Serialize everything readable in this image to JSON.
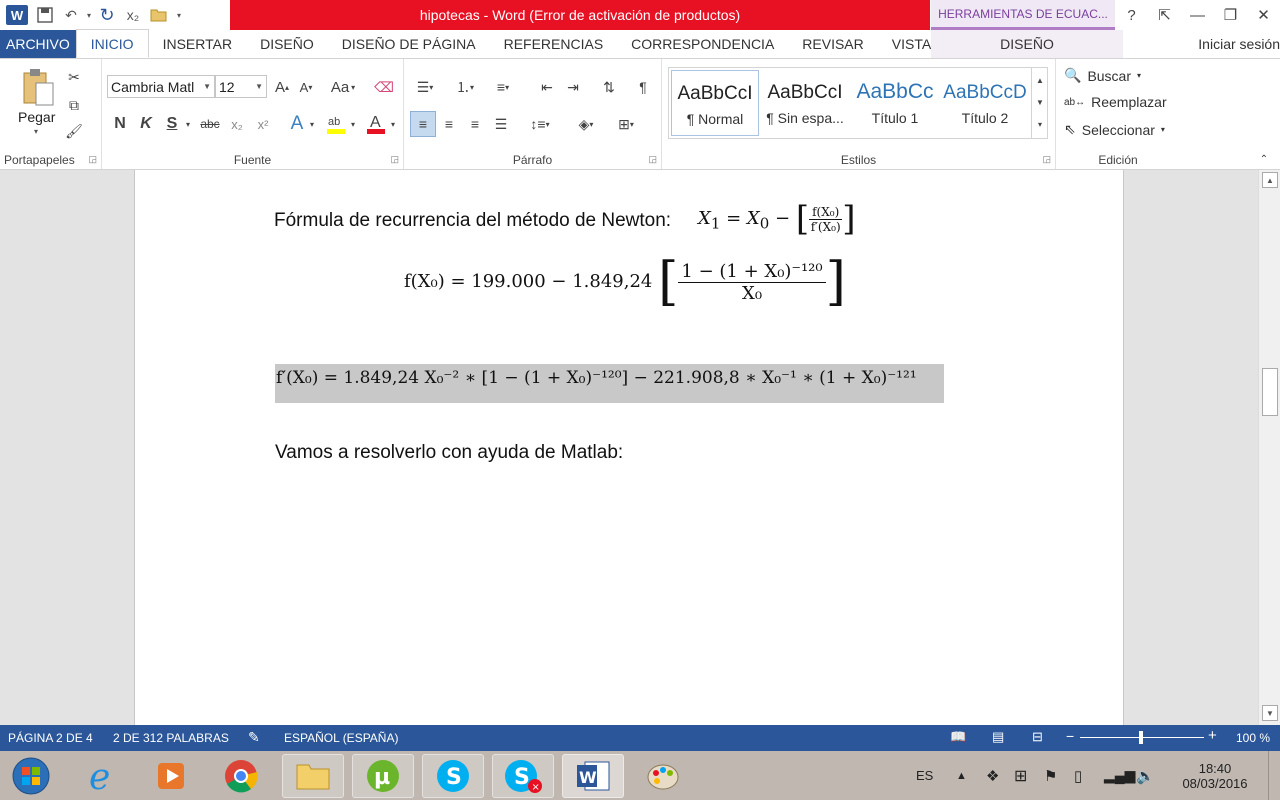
{
  "window": {
    "title": "hipotecas -  Word (Error de activación de productos)",
    "context_tab_header": "HERRAMIENTAS DE ECUAC...",
    "help": "?",
    "accent": "#2b579a",
    "title_band_color": "#e81123"
  },
  "tabs": {
    "file": "ARCHIVO",
    "items": [
      "INICIO",
      "INSERTAR",
      "DISEÑO",
      "DISEÑO DE PÁGINA",
      "REFERENCIAS",
      "CORRESPONDENCIA",
      "REVISAR",
      "VISTA"
    ],
    "active": "INICIO",
    "context": "DISEÑO",
    "signin": "Iniciar sesión"
  },
  "ribbon": {
    "clipboard": {
      "label": "Portapapeles",
      "paste": "Pegar"
    },
    "font": {
      "label": "Fuente",
      "name": "Cambria Matl",
      "size": "12",
      "bold": "N",
      "italic": "K",
      "underline": "S",
      "strike": "abc",
      "case": "Aa"
    },
    "paragraph": {
      "label": "Párrafo"
    },
    "styles": {
      "label": "Estilos",
      "items": [
        {
          "sample": "AaBbCcI",
          "name": "¶ Normal"
        },
        {
          "sample": "AaBbCcI",
          "name": "¶ Sin espa..."
        },
        {
          "sample": "AaBbCc",
          "name": "Título 1"
        },
        {
          "sample": "AaBbCcD",
          "name": "Título 2"
        }
      ]
    },
    "editing": {
      "label": "Edición",
      "find": "Buscar",
      "replace": "Reemplazar",
      "select": "Seleccionar"
    }
  },
  "document": {
    "line1_text": "Fórmula de recurrencia del método de Newton:",
    "line1_formula": {
      "lhs": "X",
      "lhs_sub": "1",
      "rhs_start": "X",
      "rhs_sub": "0",
      "minus": "−",
      "num": "f(X₀)",
      "den": "f′(X₀)"
    },
    "line2": {
      "lhs": "f(X₀) = 199.000 − 1.849,24",
      "num": "1 − (1 + X₀)⁻¹²⁰",
      "den": "X₀"
    },
    "line3": "f′(X₀) = 1.849,24 X₀⁻² ∗ [1 − (1 + X₀)⁻¹²⁰] − 221.908,8 ∗ X₀⁻¹ ∗ (1 + X₀)⁻¹²¹",
    "line4": "Vamos a resolverlo con ayuda de Matlab:"
  },
  "status": {
    "page": "PÁGINA 2 DE 4",
    "words": "2 DE 312 PALABRAS",
    "language": "ESPAÑOL (ESPAÑA)",
    "zoom": "100 %",
    "zoom_minus": "−",
    "zoom_plus": "+"
  },
  "taskbar": {
    "lang": "ES",
    "time": "18:40",
    "date": "08/03/2016"
  }
}
